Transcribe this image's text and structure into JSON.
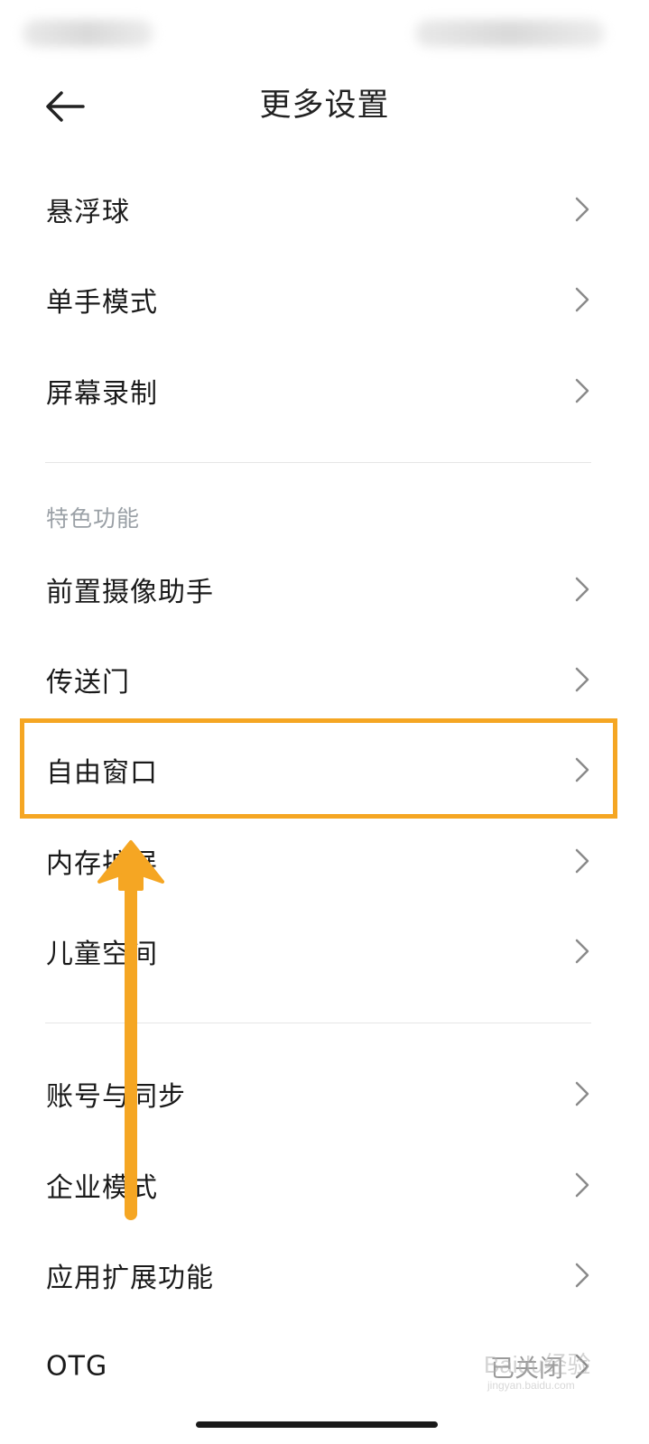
{
  "header": {
    "title": "更多设置"
  },
  "group1": {
    "items": [
      {
        "label": "悬浮球"
      },
      {
        "label": "单手模式"
      },
      {
        "label": "屏幕录制"
      }
    ]
  },
  "group2": {
    "section_title": "特色功能",
    "items": [
      {
        "label": "前置摄像助手"
      },
      {
        "label": "传送门"
      },
      {
        "label": "自由窗口"
      },
      {
        "label": "内存扩展"
      },
      {
        "label": "儿童空间"
      }
    ]
  },
  "group3": {
    "items": [
      {
        "label": "账号与同步"
      },
      {
        "label": "企业模式"
      },
      {
        "label": "应用扩展功能"
      },
      {
        "label": "OTG",
        "value": "已关闭"
      }
    ]
  },
  "watermark": {
    "main": "Baidu经验",
    "sub": "jingyan.baidu.com"
  },
  "colors": {
    "highlight": "#f5a623",
    "text_primary": "#1a1a1a",
    "text_secondary": "#9aa0a6"
  }
}
